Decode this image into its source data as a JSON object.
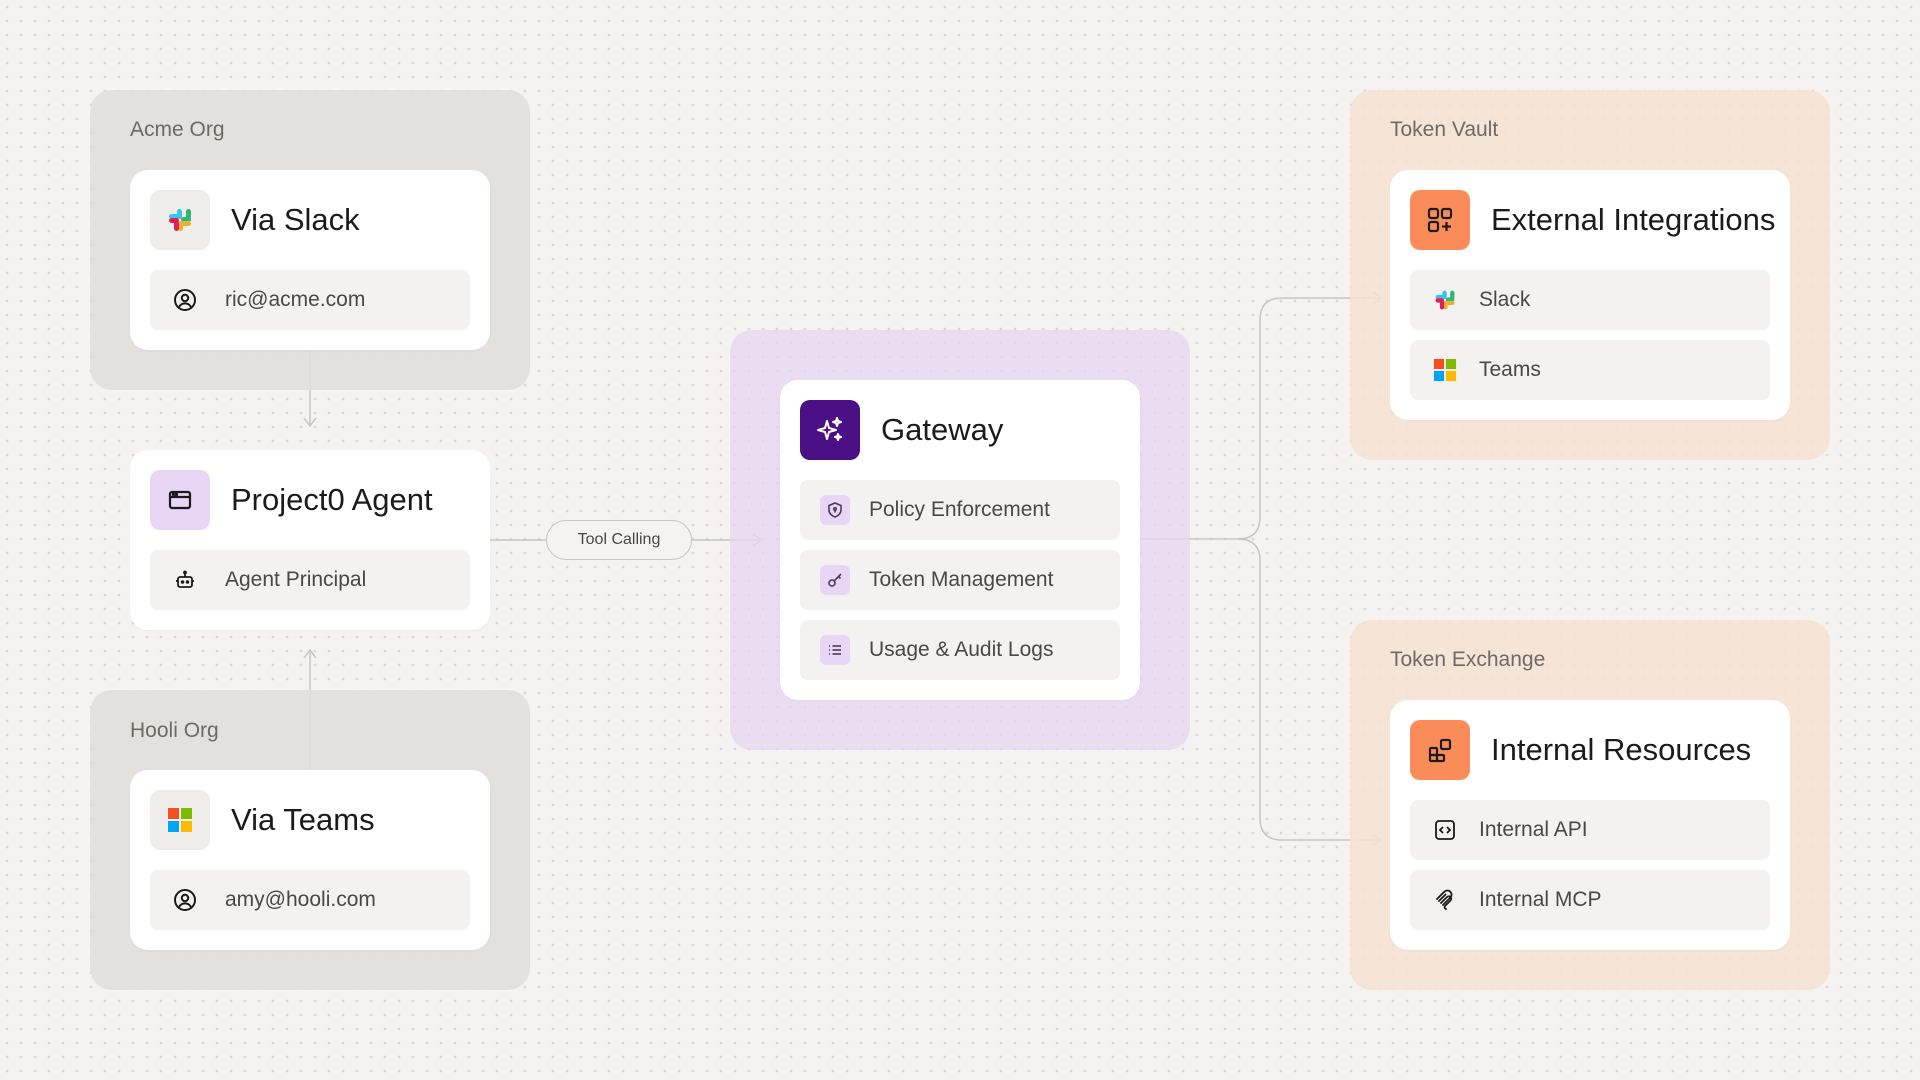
{
  "groups": {
    "acme": {
      "label": "Acme Org"
    },
    "hooli": {
      "label": "Hooli Org"
    },
    "vault": {
      "label": "Token Vault"
    },
    "exchange": {
      "label": "Token Exchange"
    }
  },
  "cards": {
    "via_slack": {
      "title": "Via Slack",
      "icon": "slack-icon",
      "rows": [
        {
          "icon": "user-circle-icon",
          "label": "ric@acme.com"
        }
      ]
    },
    "agent": {
      "title": "Project0 Agent",
      "icon": "browser-window-icon",
      "rows": [
        {
          "icon": "robot-icon",
          "label": "Agent Principal"
        }
      ]
    },
    "via_teams": {
      "title": "Via Teams",
      "icon": "microsoft-icon",
      "rows": [
        {
          "icon": "user-circle-icon",
          "label": "amy@hooli.com"
        }
      ]
    },
    "gateway": {
      "title": "Gateway",
      "icon": "sparkles-icon",
      "rows": [
        {
          "icon": "shield-icon",
          "label": "Policy Enforcement"
        },
        {
          "icon": "key-icon",
          "label": "Token Management"
        },
        {
          "icon": "list-icon",
          "label": "Usage & Audit Logs"
        }
      ]
    },
    "external": {
      "title": "External Integrations",
      "icon": "apps-add-icon",
      "rows": [
        {
          "icon": "slack-icon",
          "label": "Slack"
        },
        {
          "icon": "microsoft-icon",
          "label": "Teams"
        }
      ]
    },
    "internal": {
      "title": "Internal Resources",
      "icon": "blocks-icon",
      "rows": [
        {
          "icon": "code-icon",
          "label": "Internal API"
        },
        {
          "icon": "mcp-icon",
          "label": "Internal MCP"
        }
      ]
    }
  },
  "connector": {
    "label": "Tool Calling"
  },
  "colors": {
    "gray_group": "#e1dfdb",
    "purple_group": "#e8d6f0",
    "orange_group": "#f6e2d2",
    "gateway_icon": "#4b0f86",
    "agent_icon_bg": "#e8d6f6",
    "orange_icon": "#fb8c5a",
    "connector_line": "#c9c6c1"
  }
}
